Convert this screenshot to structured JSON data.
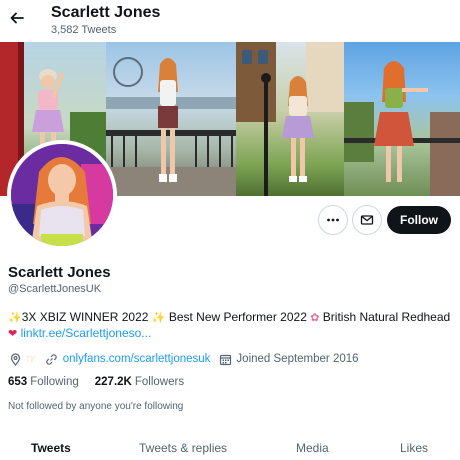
{
  "header": {
    "name": "Scarlett Jones",
    "tweet_count": "3,582 Tweets"
  },
  "profile": {
    "name": "Scarlett Jones",
    "handle": "@ScarlettJonesUK",
    "bio_line1": "3X XBIZ WINNER 2022",
    "bio_line1b": "Best New Performer 2022",
    "bio_line1c": "British Natural Redhead",
    "bio_link": "linktr.ee/Scarlettjoneso...",
    "website": "onlyfans.com/scarlettjonesuk",
    "joined": "Joined September 2016",
    "following_count": "653",
    "following_label": "Following",
    "followers_count": "227.2K",
    "followers_label": "Followers",
    "not_followed_note": "Not followed by anyone you're following"
  },
  "actions": {
    "follow_label": "Follow"
  },
  "tabs": [
    {
      "label": "Tweets",
      "active": true
    },
    {
      "label": "Tweets & replies",
      "active": false
    },
    {
      "label": "Media",
      "active": false
    },
    {
      "label": "Likes",
      "active": false
    }
  ],
  "icons": {
    "back": "arrow-left-icon",
    "more": "more-horizontal-icon",
    "mail": "mail-icon",
    "location": "location-pin-icon",
    "link": "link-icon",
    "calendar": "calendar-icon"
  },
  "colors": {
    "accent": "#1d9bf0",
    "follow_button": "#0f1419",
    "muted_text": "#536471"
  }
}
